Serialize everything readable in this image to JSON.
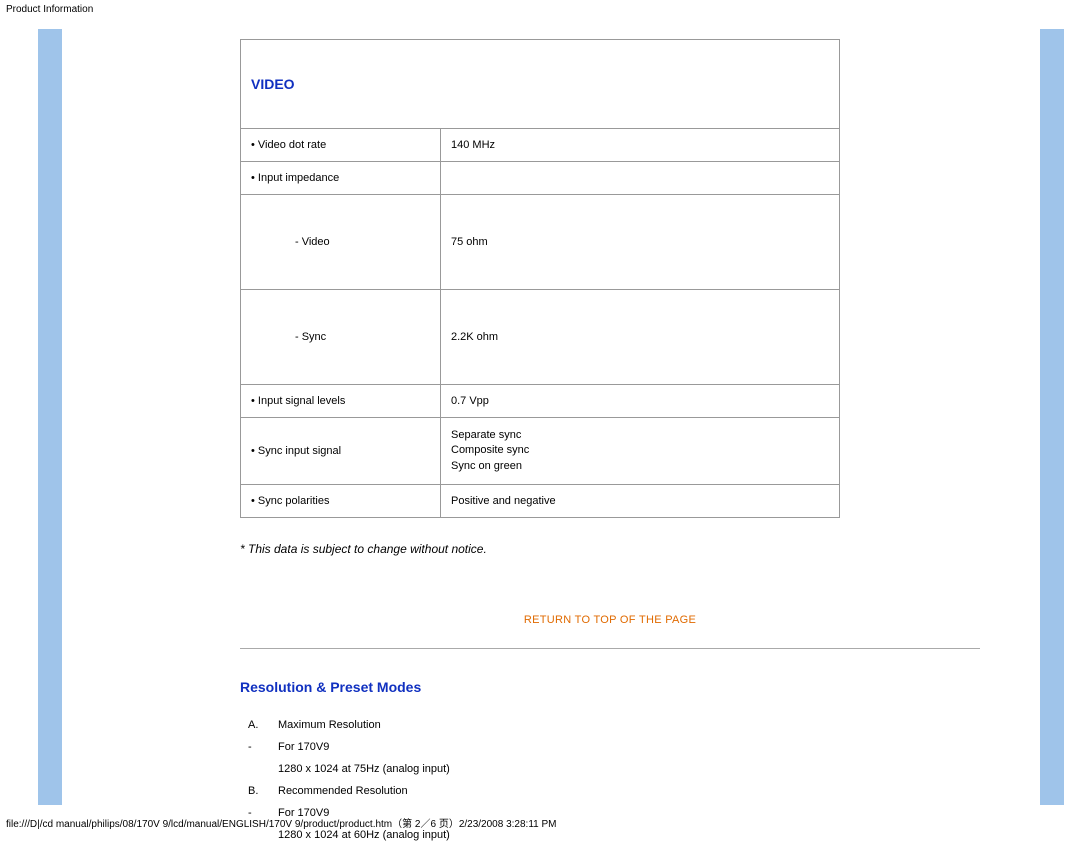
{
  "header": {
    "title": "Product Information"
  },
  "video": {
    "section_title": "VIDEO",
    "rows": {
      "dot_rate": {
        "label": "• Video dot rate",
        "value": "140 MHz"
      },
      "impedance": {
        "label": "• Input impedance",
        "value": ""
      },
      "imp_video": {
        "label": "- Video",
        "value": "75 ohm"
      },
      "imp_sync": {
        "label": "- Sync",
        "value": "2.2K ohm"
      },
      "sig_levels": {
        "label": "• Input signal levels",
        "value": "0.7 Vpp"
      },
      "sync_input": {
        "label": "• Sync input signal",
        "values": [
          "Separate sync",
          "Composite sync",
          "Sync on green"
        ]
      },
      "polarities": {
        "label": "• Sync polarities",
        "value": "Positive and negative"
      }
    }
  },
  "notice": "* This data is subject to change without notice.",
  "top_link": "RETURN TO TOP OF THE PAGE",
  "resolution": {
    "section_title": "Resolution & Preset Modes",
    "lines": [
      {
        "key": "A.",
        "text": "Maximum Resolution"
      },
      {
        "key": "-",
        "text": "For 170V9"
      },
      {
        "key": "",
        "text": "1280 x 1024 at 75Hz (analog input)"
      },
      {
        "key": "B.",
        "text": "Recommended Resolution"
      },
      {
        "key": "-",
        "text": "For 170V9"
      },
      {
        "key": "",
        "text": "1280 x 1024 at 60Hz (analog input)"
      }
    ]
  },
  "footer": "file:///D|/cd manual/philips/08/170V 9/lcd/manual/ENGLISH/170V 9/product/product.htm（第 2／6 页）2/23/2008 3:28:11 PM"
}
